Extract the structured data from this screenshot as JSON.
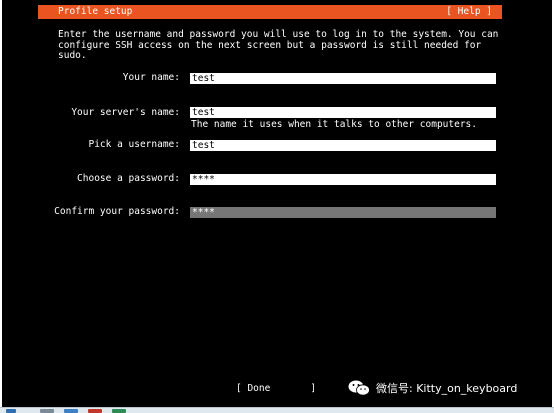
{
  "header": {
    "title": "Profile setup",
    "help_label": "[ Help ]"
  },
  "intro_text": "Enter the username and password you will use to log in to the system. You can configure SSH access on the next screen but a password is still needed for sudo.",
  "form": {
    "your_name": {
      "label": "Your name:",
      "value": "test"
    },
    "server_name": {
      "label": "Your server's name:",
      "value": "test",
      "hint": "The name it uses when it talks to other computers."
    },
    "username": {
      "label": "Pick a username:",
      "value": "test"
    },
    "password": {
      "label": "Choose a password:",
      "value": "****"
    },
    "confirm_password": {
      "label": "Confirm your password:",
      "value": "****"
    }
  },
  "done_label": "[ Done       ]",
  "watermark": {
    "text": "微信号: Kitty_on_keyboard",
    "icon": "wechat-icon"
  },
  "colors": {
    "header_accent": "#e95420",
    "background": "#000000",
    "field_bg": "#ffffff",
    "focused_field_bg": "#767676"
  }
}
